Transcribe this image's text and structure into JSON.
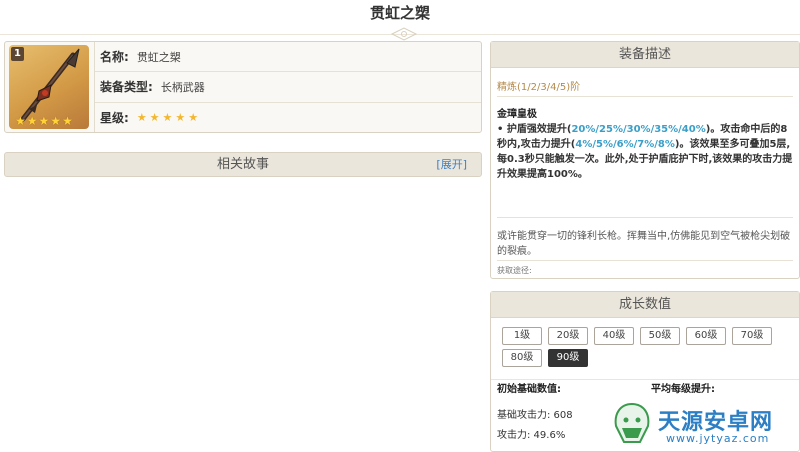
{
  "page": {
    "title": "贯虹之槊"
  },
  "weapon": {
    "refinement_badge": "1",
    "stars": "★★★★★",
    "rows": [
      {
        "label": "名称:",
        "value": "贯虹之槊"
      },
      {
        "label": "装备类型:",
        "value": "长柄武器"
      },
      {
        "label": "星级:",
        "value": "★★★★★"
      }
    ]
  },
  "story": {
    "title": "相关故事",
    "toggle": "[展开]"
  },
  "description": {
    "header": "装备描述",
    "refinement": "精炼(1/2/3/4/5)阶",
    "passive_name": "金璋皇极",
    "passive_parts": [
      "• 护盾强效提升(",
      "20%/25%/30%/35%/40%",
      ")。攻击命中后的8秒内,攻击力提升(",
      "4%/5%/6%/7%/8%",
      ")。该效果至多可叠加5层,每0.3秒只能触发一次。此外,处于护盾庇护下时,该效果的攻击力提升效果提高100%。"
    ],
    "flavor": "或许能贯穿一切的锋利长枪。挥舞当中,仿佛能见到空气被枪尖划破的裂痕。",
    "source": "获取途径:"
  },
  "growth": {
    "header": "成长数值",
    "levels": [
      "1级",
      "20级",
      "40级",
      "50级",
      "60级",
      "70级",
      "80级",
      "90级"
    ],
    "active_level": "90级",
    "base_header": "初始基础数值:",
    "avg_header": "平均每级提升:",
    "stats": [
      {
        "label": "基础攻击力: 608"
      },
      {
        "label": "攻击力: 49.6%"
      }
    ]
  },
  "watermark": {
    "title": "天源安卓网",
    "url": "www.jytyaz.com"
  },
  "colors": {
    "accent_blue": "#3a9fc8",
    "header_bg": "#ebe6dc",
    "star": "#f3b72f"
  }
}
